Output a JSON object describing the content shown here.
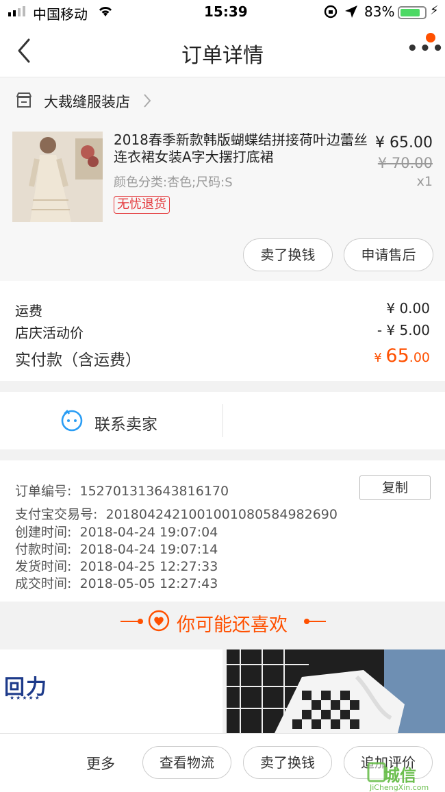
{
  "status_bar": {
    "carrier": "中国移动",
    "time": "15:39",
    "battery": "83%",
    "battery_level": 0.83
  },
  "nav": {
    "title": "订单详情"
  },
  "shop": {
    "name": "大裁缝服装店"
  },
  "item": {
    "title": "2018春季新款韩版蝴蝶结拼接荷叶边蕾丝连衣裙女装A字大摆打底裙",
    "spec": "颜色分类:杏色;尺码:S",
    "tag": "无忧退货",
    "price": "¥ 65.00",
    "original_price": "¥ 70.00",
    "quantity": "x1",
    "buttons": {
      "sell": "卖了换钱",
      "after_sale": "申请售后"
    }
  },
  "fees": {
    "shipping_label": "运费",
    "shipping_value": "¥ 0.00",
    "discount_label": "店庆活动价",
    "discount_value": "- ¥ 5.00",
    "paid_label": "实付款（含运费）",
    "paid_currency": "¥ ",
    "paid_int": "65",
    "paid_dec": ".00"
  },
  "contact": {
    "label": "联系卖家"
  },
  "order_info": {
    "order_no_label": "订单编号:",
    "order_no": "152701313643816170",
    "copy_label": "复制",
    "alipay_label": "支付宝交易号:",
    "alipay_no": "2018042421001001080584982690",
    "created_label": "创建时间:",
    "created": "2018-04-24 19:07:04",
    "paid_label": "付款时间:",
    "paid": "2018-04-24 19:07:14",
    "shipped_label": "发货时间:",
    "shipped": "2018-04-25 12:27:33",
    "completed_label": "成交时间:",
    "completed": "2018-05-05 12:27:43"
  },
  "recommend": {
    "title": "你可能还喜欢",
    "product1_logo": "回力"
  },
  "bottom_bar": {
    "more": "更多",
    "logistics": "查看物流",
    "sell": "卖了换钱",
    "review": "追加评价"
  },
  "watermark": {
    "text": "城信",
    "sub": "JiChengXin.com"
  },
  "colors": {
    "accent": "#ff5000",
    "tag_red": "#e4393c",
    "contact_blue": "#2a9df4"
  }
}
